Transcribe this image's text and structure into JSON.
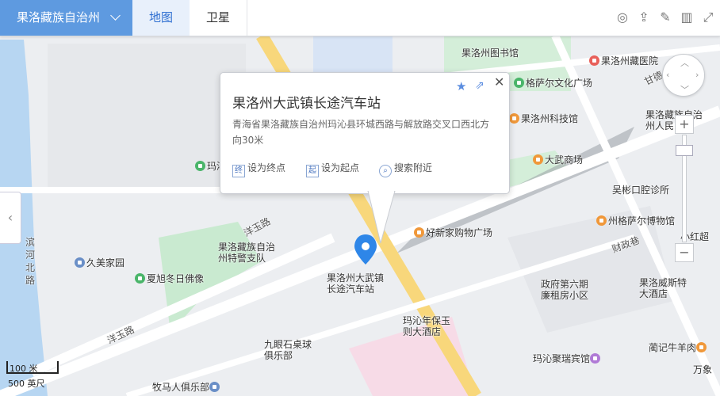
{
  "topbar": {
    "city": "果洛藏族自治州",
    "tabs": [
      "地图",
      "卫星"
    ]
  },
  "infowindow": {
    "title": "果洛州大武镇长途汽车站",
    "address": "青海省果洛藏族自治州玛沁县环城西路与解放路交叉口西北方向30米",
    "actions": {
      "end": {
        "icon": "终",
        "label": "设为终点"
      },
      "start": {
        "icon": "起",
        "label": "设为起点"
      },
      "nearby": {
        "label": "搜索附近"
      }
    }
  },
  "scale": {
    "meters": "100 米",
    "feet": "500 英尺"
  },
  "map": {
    "pois": [
      {
        "name": "果洛州图书馆",
        "color": "none"
      },
      {
        "name": "果洛州藏医院",
        "color": "red"
      },
      {
        "name": "格萨尔文化广场",
        "color": "green"
      },
      {
        "name": "果洛州科技馆",
        "color": "orange"
      },
      {
        "name": "果洛藏族自治州人民医院",
        "color": "red"
      },
      {
        "name": "大武商场",
        "color": "orange"
      },
      {
        "name": "吴彬口腔诊所",
        "color": "red"
      },
      {
        "name": "州格萨尔博物馆",
        "color": "orange"
      },
      {
        "name": "小红超",
        "color": "orange"
      },
      {
        "name": "果洛威斯特大酒店",
        "color": "purple"
      },
      {
        "name": "玛沁",
        "color": "green"
      },
      {
        "name": "好新家购物广场",
        "color": "orange"
      },
      {
        "name": "果洛藏族自治州特警支队",
        "color": "red"
      },
      {
        "name": "果洛州大武镇长途汽车站",
        "color": "blue"
      },
      {
        "name": "久美家园",
        "color": "blue"
      },
      {
        "name": "夏旭冬日佛像",
        "color": "green"
      },
      {
        "name": "政府第六期廉租房小区",
        "color": "blue"
      },
      {
        "name": "玛沁年保玉则大酒店",
        "color": "purple"
      },
      {
        "name": "九眼石桌球俱乐部",
        "color": "teal"
      },
      {
        "name": "玛沁聚瑞宾馆",
        "color": "purple"
      },
      {
        "name": "蔺记牛羊肉",
        "color": "orange"
      },
      {
        "name": "万象",
        "color": "red"
      },
      {
        "name": "牧马人俱乐部",
        "color": "blue"
      }
    ],
    "roads": [
      "洋玉路",
      "洋玉路",
      "滨河北路",
      "财政巷",
      "甘德"
    ]
  }
}
